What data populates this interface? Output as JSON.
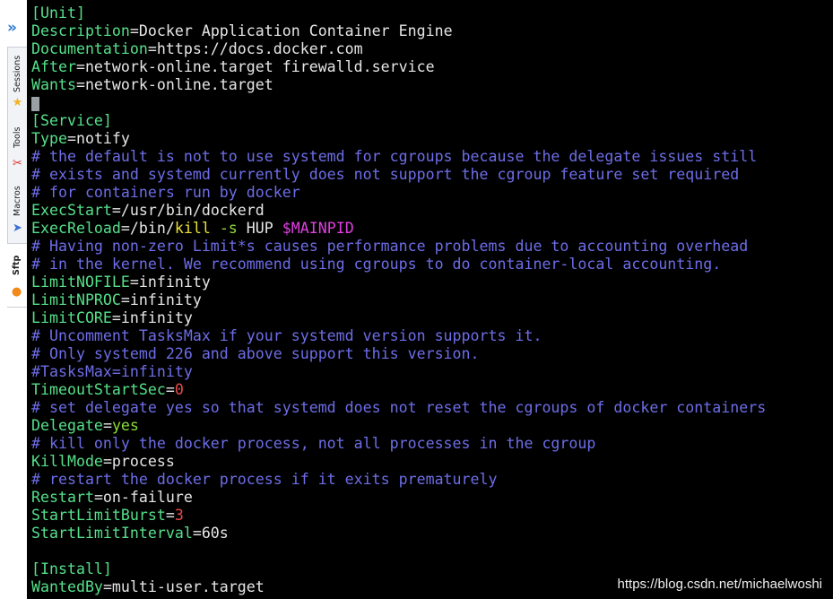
{
  "sidebar": {
    "tabs": [
      {
        "label": "Sessions",
        "icon": "star-icon"
      },
      {
        "label": "Tools",
        "icon": "tools-icon"
      },
      {
        "label": "Macros",
        "icon": "macros-icon"
      },
      {
        "label": "Sftp",
        "icon": "sftp-icon"
      }
    ]
  },
  "terminal": {
    "l1": {
      "a": "[Unit]"
    },
    "l2": {
      "k": "Description",
      "v": "=Docker Application Container Engine"
    },
    "l3": {
      "k": "Documentation",
      "v": "=https://docs.docker.com"
    },
    "l4": {
      "k": "After",
      "v": "=network-online.target firewalld.service"
    },
    "l5": {
      "k": "Wants",
      "v": "=network-online.target"
    },
    "l7": {
      "a": "[Service]"
    },
    "l8": {
      "k": "Type",
      "v": "=notify"
    },
    "l9": {
      "c": "# the default is not to use systemd for cgroups because the delegate issues still"
    },
    "l10": {
      "c": "# exists and systemd currently does not support the cgroup feature set required"
    },
    "l11": {
      "c": "# for containers run by docker"
    },
    "l12": {
      "k": "ExecStart",
      "v": "=/usr/bin/dockerd"
    },
    "l13": {
      "k": "ExecReload",
      "v1": "=/bin/",
      "kill": "kill",
      "flag": " -s",
      "v2": " HUP ",
      "var": "$MAINPID"
    },
    "l14": {
      "c": "# Having non-zero Limit*s causes performance problems due to accounting overhead"
    },
    "l15": {
      "c": "# in the kernel. We recommend using cgroups to do container-local accounting."
    },
    "l16": {
      "k": "LimitNOFILE",
      "v": "=infinity"
    },
    "l17": {
      "k": "LimitNPROC",
      "v": "=infinity"
    },
    "l18": {
      "k": "LimitCORE",
      "v": "=infinity"
    },
    "l19": {
      "c": "# Uncomment TasksMax if your systemd version supports it."
    },
    "l20": {
      "c": "# Only systemd 226 and above support this version."
    },
    "l21": {
      "c": "#TasksMax=infinity"
    },
    "l22": {
      "k": "TimeoutStartSec",
      "eq": "=",
      "n": "0"
    },
    "l23": {
      "c": "# set delegate yes so that systemd does not reset the cgroups of docker containers"
    },
    "l24": {
      "k": "Delegate",
      "eq": "=",
      "y": "yes"
    },
    "l25": {
      "c": "# kill only the docker process, not all processes in the cgroup"
    },
    "l26": {
      "k": "KillMode",
      "v": "=process"
    },
    "l27": {
      "c": "# restart the docker process if it exits prematurely"
    },
    "l28": {
      "k": "Restart",
      "v": "=on-failure"
    },
    "l29": {
      "k": "StartLimitBurst",
      "eq": "=",
      "n": "3"
    },
    "l30": {
      "k": "StartLimitInterval",
      "v": "=60s"
    },
    "l32": {
      "a": "[Install]"
    },
    "l33": {
      "k": "WantedBy",
      "v": "=multi-user.target"
    }
  },
  "watermark": "https://blog.csdn.net/michaelwoshi"
}
